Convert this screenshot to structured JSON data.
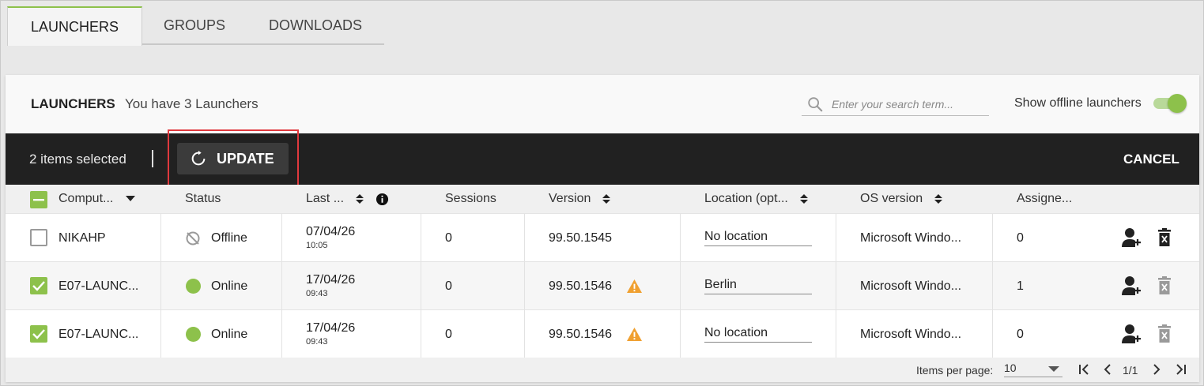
{
  "tabs": [
    {
      "label": "LAUNCHERS",
      "active": true
    },
    {
      "label": "GROUPS",
      "active": false
    },
    {
      "label": "DOWNLOADS",
      "active": false
    }
  ],
  "panel": {
    "title": "LAUNCHERS",
    "subtitle": "You have 3 Launchers",
    "search_placeholder": "Enter your search term...",
    "offline_toggle_label": "Show offline launchers",
    "offline_toggle_on": true
  },
  "actionbar": {
    "selected_text": "2 items selected",
    "update_label": "UPDATE",
    "cancel_label": "CANCEL"
  },
  "columns": [
    "Comput...",
    "Status",
    "Last ...",
    "Sessions",
    "Version",
    "Location (opt...",
    "OS version",
    "Assigne..."
  ],
  "rows": [
    {
      "checked": false,
      "computer": "NIKAHP",
      "status": "Offline",
      "date": "07/04/26",
      "time": "10:05",
      "sessions": "0",
      "version": "99.50.1545",
      "warning": false,
      "location": "No location",
      "os": "Microsoft Windo...",
      "assigned": "0"
    },
    {
      "checked": true,
      "computer": "E07-LAUNC...",
      "status": "Online",
      "date": "17/04/26",
      "time": "09:43",
      "sessions": "0",
      "version": "99.50.1546",
      "warning": true,
      "location": "Berlin",
      "os": "Microsoft Windo...",
      "assigned": "1"
    },
    {
      "checked": true,
      "computer": "E07-LAUNC...",
      "status": "Online",
      "date": "17/04/26",
      "time": "09:43",
      "sessions": "0",
      "version": "99.50.1546",
      "warning": true,
      "location": "No location",
      "os": "Microsoft Windo...",
      "assigned": "0"
    }
  ],
  "footer": {
    "items_per_page_label": "Items per page:",
    "items_per_page_value": "10",
    "page_text": "1/1"
  },
  "colors": {
    "accent": "#8dc14b",
    "warning": "#f0a030",
    "highlight": "#e0393e",
    "actionbar": "#212121"
  }
}
